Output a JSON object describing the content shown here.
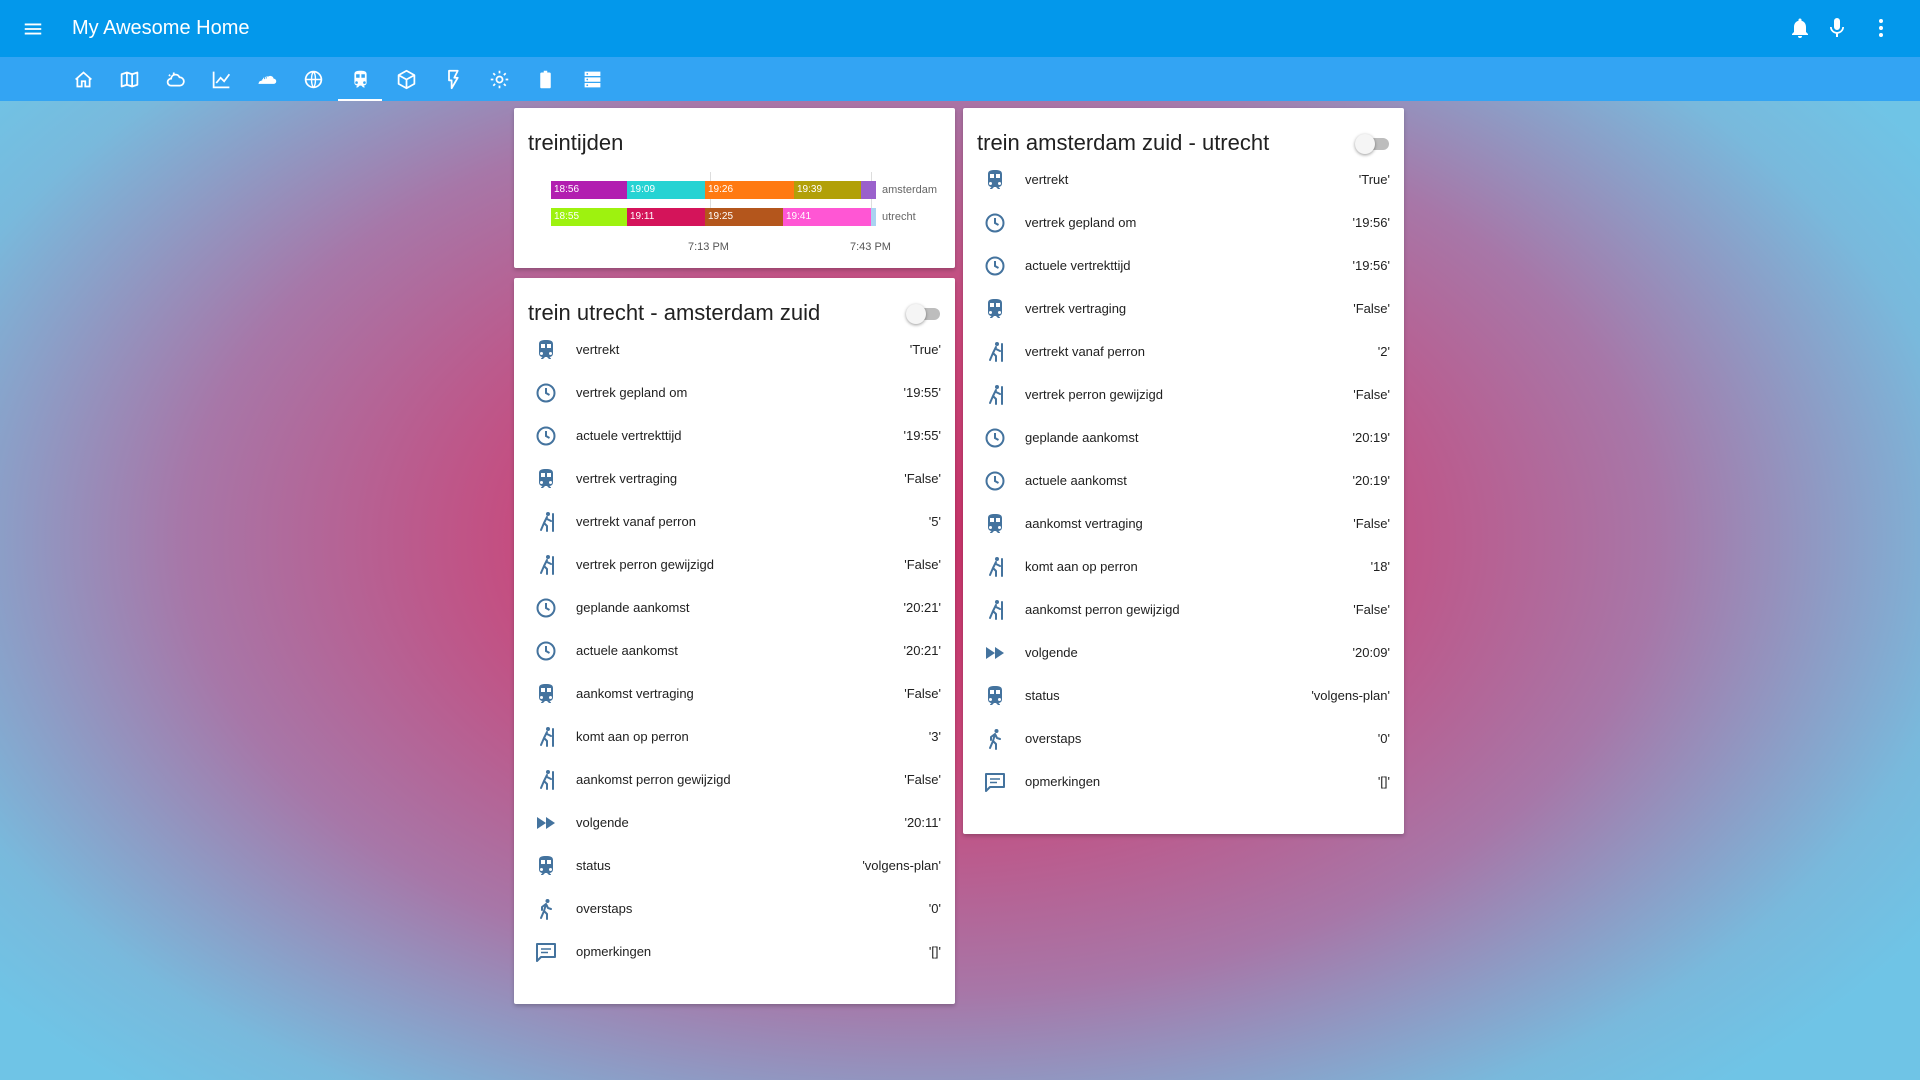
{
  "app": {
    "title": "My Awesome Home"
  },
  "header_icons": [
    "menu-icon",
    "bell-icon",
    "microphone-icon",
    "more-vert-icon"
  ],
  "tabs": [
    "home-icon",
    "map-icon",
    "weather-icon",
    "chart-icon",
    "cloud-icon",
    "globe-icon",
    "train-icon",
    "cube-icon",
    "flash-icon",
    "settings-icon",
    "battery-icon",
    "server-icon"
  ],
  "active_tab": "train-icon",
  "timeline": {
    "title": "treintijden",
    "rows": [
      {
        "label": "amsterdam",
        "segments": [
          {
            "text": "18:56",
            "color": "#b21eb0"
          },
          {
            "text": "19:09",
            "color": "#26d3d3"
          },
          {
            "text": "19:26",
            "color": "#ff7a12"
          },
          {
            "text": "19:39",
            "color": "#b2a008"
          },
          {
            "text": "",
            "color": "#9a61cc"
          }
        ]
      },
      {
        "label": "utrecht",
        "segments": [
          {
            "text": "18:55",
            "color": "#9ef20f"
          },
          {
            "text": "19:11",
            "color": "#d4145a"
          },
          {
            "text": "19:25",
            "color": "#b4561c"
          },
          {
            "text": "19:41",
            "color": "#ff56d4"
          },
          {
            "text": "",
            "color": "#a9d3f1"
          }
        ]
      }
    ],
    "axis": [
      "7:13 PM",
      "7:43 PM"
    ]
  },
  "card_left": {
    "title": "trein utrecht - amsterdam zuid",
    "rows": [
      {
        "icon": "train-icon",
        "label": "vertrekt",
        "value": "'True'"
      },
      {
        "icon": "clock-icon",
        "label": "vertrek gepland om",
        "value": "'19:55'"
      },
      {
        "icon": "clock-icon",
        "label": "actuele vertrekttijd",
        "value": "'19:55'"
      },
      {
        "icon": "train-icon",
        "label": "vertrek vertraging",
        "value": "'False'"
      },
      {
        "icon": "platform-icon",
        "label": "vertrekt vanaf perron",
        "value": "'5'"
      },
      {
        "icon": "platform-icon",
        "label": "vertrek perron gewijzigd",
        "value": "'False'"
      },
      {
        "icon": "clock-icon",
        "label": "geplande aankomst",
        "value": "'20:21'"
      },
      {
        "icon": "clock-icon",
        "label": "actuele aankomst",
        "value": "'20:21'"
      },
      {
        "icon": "train-icon",
        "label": "aankomst vertraging",
        "value": "'False'"
      },
      {
        "icon": "platform-icon",
        "label": "komt aan op perron",
        "value": "'3'"
      },
      {
        "icon": "platform-icon",
        "label": "aankomst perron gewijzigd",
        "value": "'False'"
      },
      {
        "icon": "fast-forward-icon",
        "label": "volgende",
        "value": "'20:11'"
      },
      {
        "icon": "train-icon",
        "label": "status",
        "value": "'volgens-plan'"
      },
      {
        "icon": "walk-icon",
        "label": "overstaps",
        "value": "'0'"
      },
      {
        "icon": "comment-icon",
        "label": "opmerkingen",
        "value": "'[]'"
      }
    ]
  },
  "card_right": {
    "title": "trein amsterdam zuid - utrecht",
    "rows": [
      {
        "icon": "train-icon",
        "label": "vertrekt",
        "value": "'True'"
      },
      {
        "icon": "clock-icon",
        "label": "vertrek gepland om",
        "value": "'19:56'"
      },
      {
        "icon": "clock-icon",
        "label": "actuele vertrekttijd",
        "value": "'19:56'"
      },
      {
        "icon": "train-icon",
        "label": "vertrek vertraging",
        "value": "'False'"
      },
      {
        "icon": "platform-icon",
        "label": "vertrekt vanaf perron",
        "value": "'2'"
      },
      {
        "icon": "platform-icon",
        "label": "vertrek perron gewijzigd",
        "value": "'False'"
      },
      {
        "icon": "clock-icon",
        "label": "geplande aankomst",
        "value": "'20:19'"
      },
      {
        "icon": "clock-icon",
        "label": "actuele aankomst",
        "value": "'20:19'"
      },
      {
        "icon": "train-icon",
        "label": "aankomst vertraging",
        "value": "'False'"
      },
      {
        "icon": "platform-icon",
        "label": "komt aan op perron",
        "value": "'18'"
      },
      {
        "icon": "platform-icon",
        "label": "aankomst perron gewijzigd",
        "value": "'False'"
      },
      {
        "icon": "fast-forward-icon",
        "label": "volgende",
        "value": "'20:09'"
      },
      {
        "icon": "train-icon",
        "label": "status",
        "value": "'volgens-plan'"
      },
      {
        "icon": "walk-icon",
        "label": "overstaps",
        "value": "'0'"
      },
      {
        "icon": "comment-icon",
        "label": "opmerkingen",
        "value": "'[]'"
      }
    ]
  },
  "colors": {
    "appbar": "#0398eb",
    "tabbar": "#33a4f3",
    "icon": "#44739e"
  }
}
